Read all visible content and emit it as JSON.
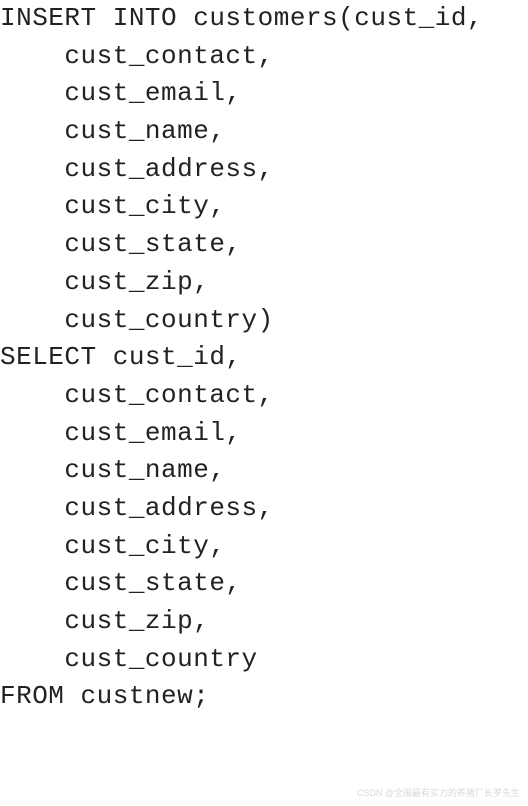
{
  "code": {
    "lines": [
      "INSERT INTO customers(cust_id,",
      "    cust_contact,",
      "    cust_email,",
      "    cust_name,",
      "    cust_address,",
      "    cust_city,",
      "    cust_state,",
      "    cust_zip,",
      "    cust_country)",
      "SELECT cust_id,",
      "    cust_contact,",
      "    cust_email,",
      "    cust_name,",
      "    cust_address,",
      "    cust_city,",
      "    cust_state,",
      "    cust_zip,",
      "    cust_country",
      "FROM custnew;"
    ]
  },
  "watermark": "CSDN @全国最有实力的养猪厂长罗先生"
}
